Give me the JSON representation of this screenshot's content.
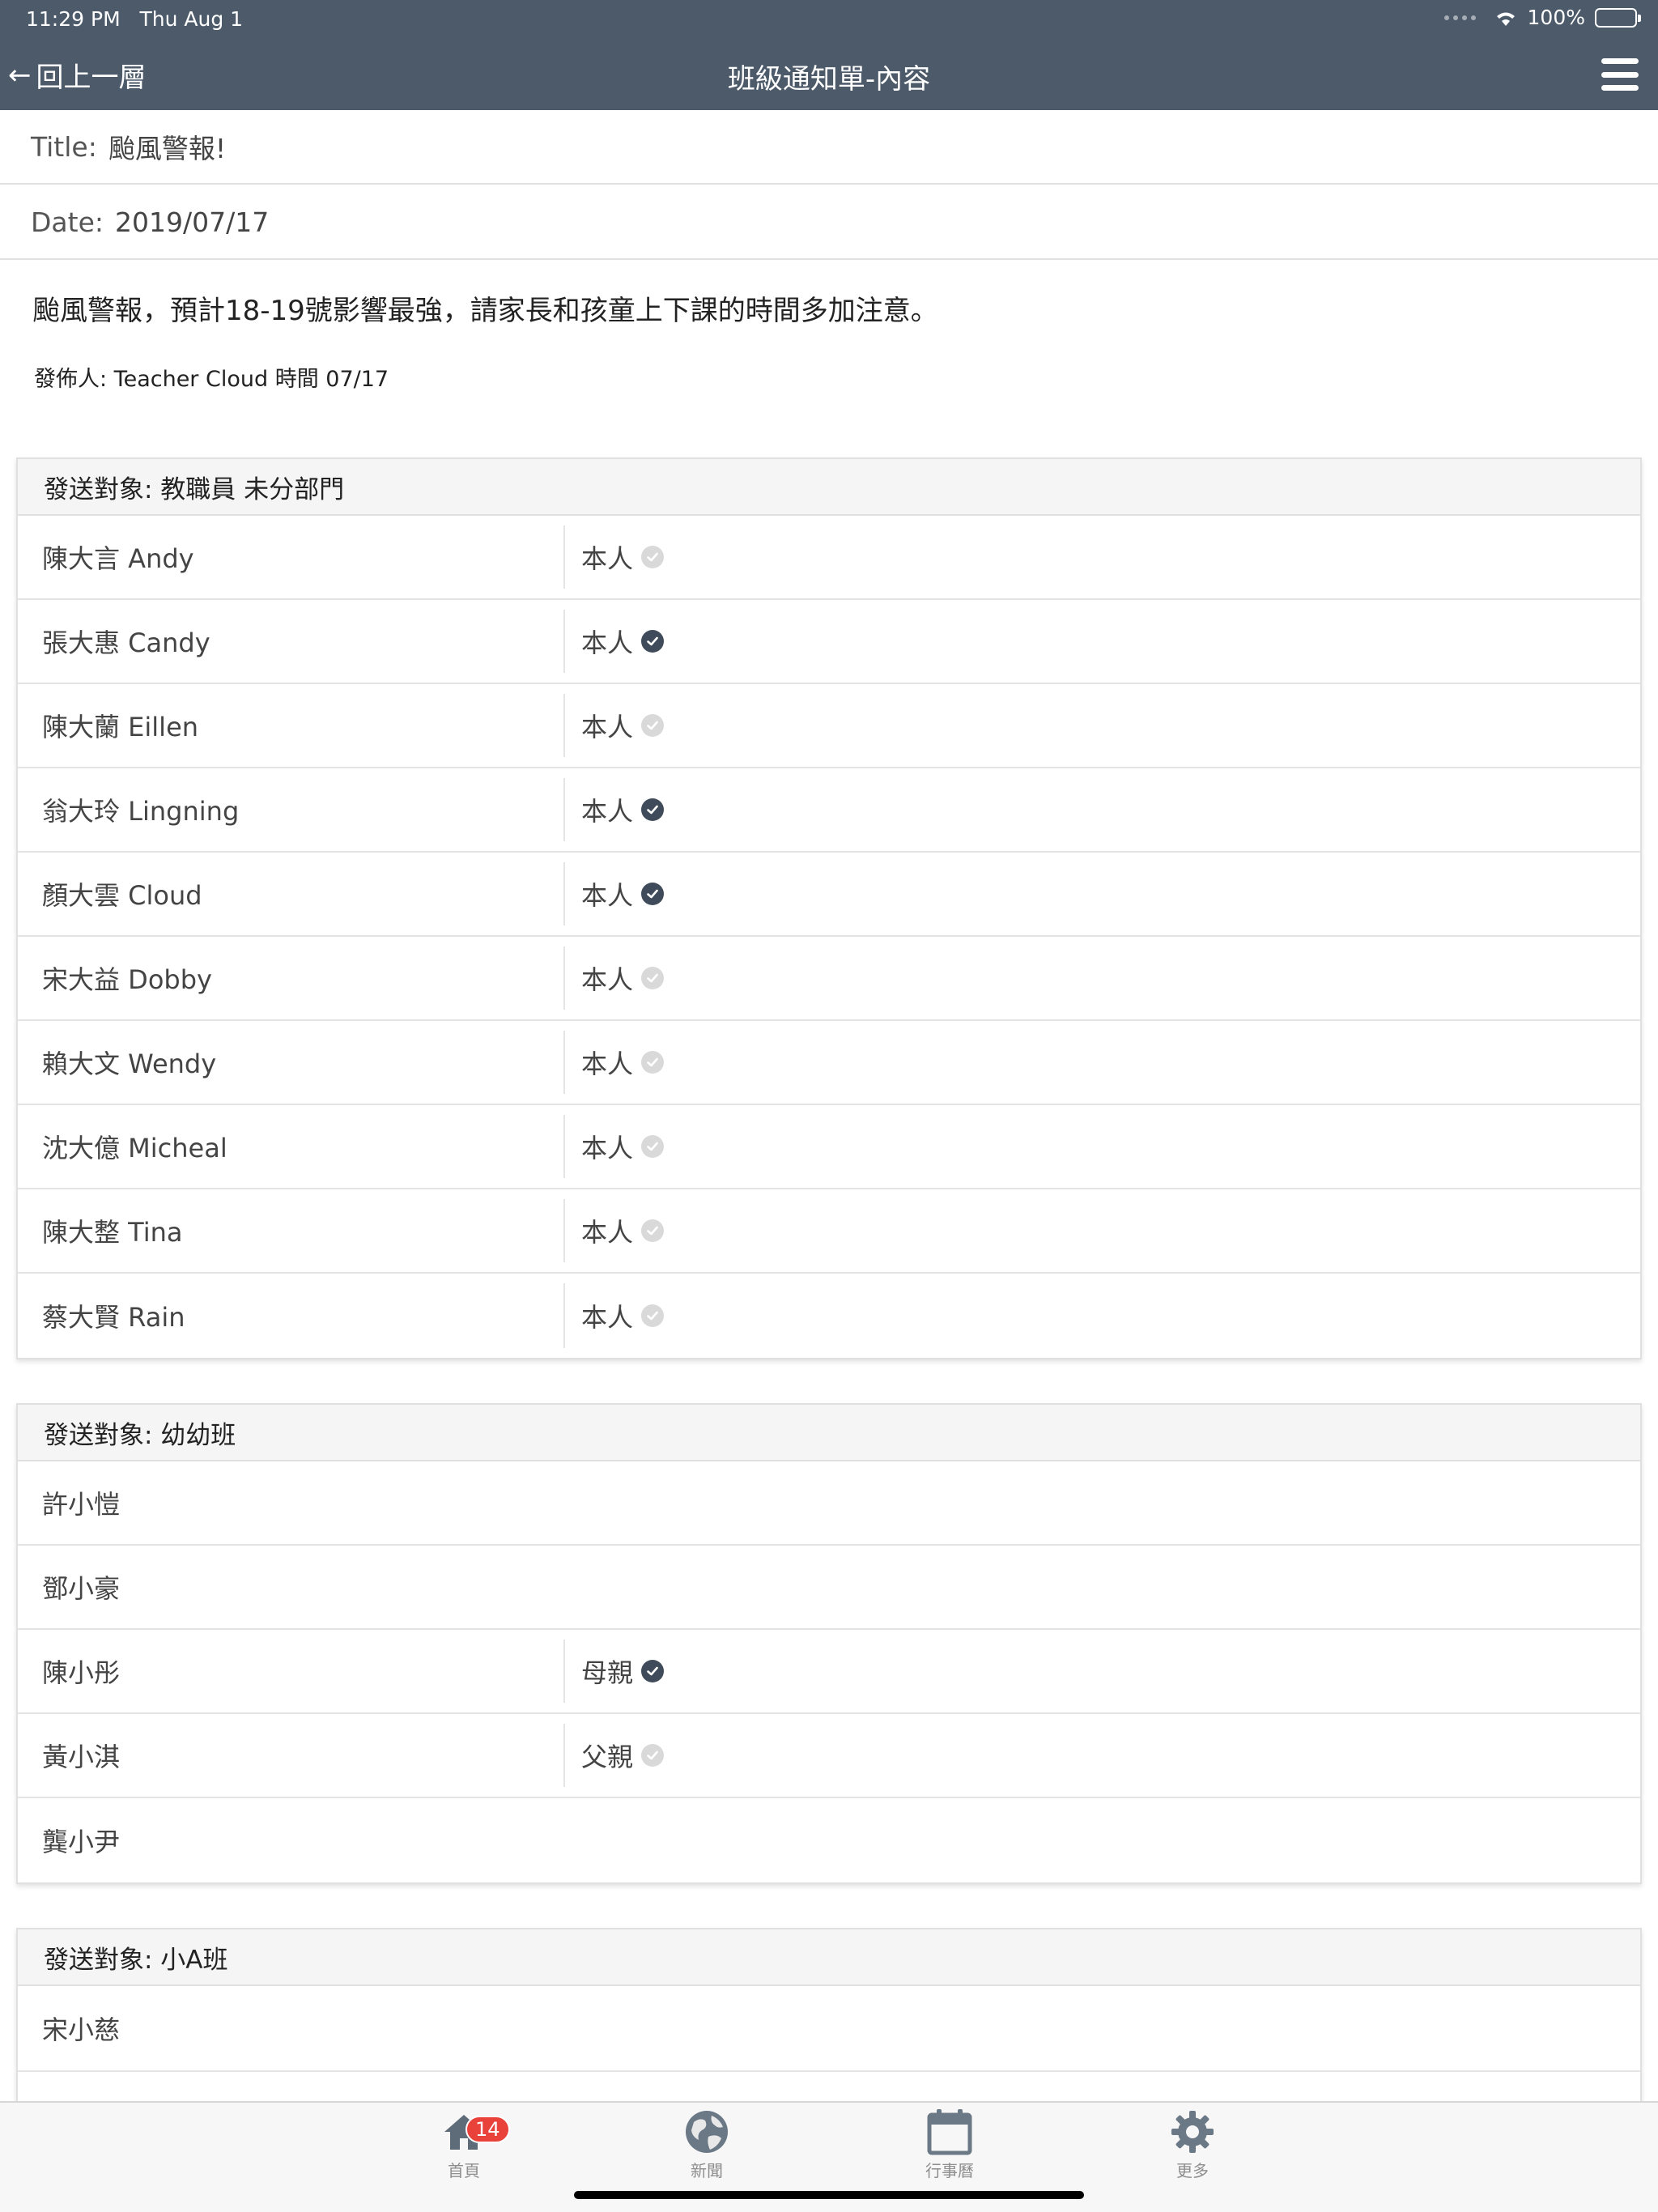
{
  "status_bar": {
    "time": "11:29 PM",
    "date": "Thu Aug 1",
    "battery": "100%"
  },
  "nav": {
    "back_label": "回上一層",
    "title": "班級通知單-內容"
  },
  "notice": {
    "title_label": "Title:",
    "title_value": "颱風警報!",
    "date_label": "Date:",
    "date_value": "2019/07/17",
    "message": "颱風警報，預計18-19號影響最強，請家長和孩童上下課的時間多加注意。",
    "publisher": "發佈人: Teacher Cloud 時間 07/17"
  },
  "sections": [
    {
      "header": "發送對象: 教職員 未分部門",
      "rows": [
        {
          "name": "陳大言 Andy",
          "status": "本人",
          "checked": false
        },
        {
          "name": "張大惠 Candy",
          "status": "本人",
          "checked": true
        },
        {
          "name": "陳大蘭 Eillen",
          "status": "本人",
          "checked": false
        },
        {
          "name": "翁大玲 Lingning",
          "status": "本人",
          "checked": true
        },
        {
          "name": "顏大雲 Cloud",
          "status": "本人",
          "checked": true
        },
        {
          "name": "宋大益 Dobby",
          "status": "本人",
          "checked": false
        },
        {
          "name": "賴大文 Wendy",
          "status": "本人",
          "checked": false
        },
        {
          "name": "沈大億 Micheal",
          "status": "本人",
          "checked": false
        },
        {
          "name": "陳大整 Tina",
          "status": "本人",
          "checked": false
        },
        {
          "name": "蔡大賢 Rain",
          "status": "本人",
          "checked": false
        }
      ]
    },
    {
      "header": "發送對象: 幼幼班",
      "rows": [
        {
          "name": "許小愷"
        },
        {
          "name": "鄧小豪"
        },
        {
          "name": "陳小彤",
          "status": "母親",
          "checked": true
        },
        {
          "name": "黃小淇",
          "status": "父親",
          "checked": false
        },
        {
          "name": "龔小尹"
        }
      ]
    },
    {
      "header": "發送對象: 小A班",
      "rows": [
        {
          "name": "宋小慈"
        }
      ]
    }
  ],
  "tabbar": {
    "tabs": [
      {
        "label": "首頁",
        "icon": "home-icon",
        "badge": "14"
      },
      {
        "label": "新聞",
        "icon": "globe-icon"
      },
      {
        "label": "行事曆",
        "icon": "calendar-icon"
      },
      {
        "label": "更多",
        "icon": "gear-icon"
      }
    ]
  },
  "colors": {
    "nav_bg": "#4c5a6a",
    "check_on": "#3f4b5a",
    "check_off": "#d9d9d9",
    "badge": "#e8423a"
  }
}
